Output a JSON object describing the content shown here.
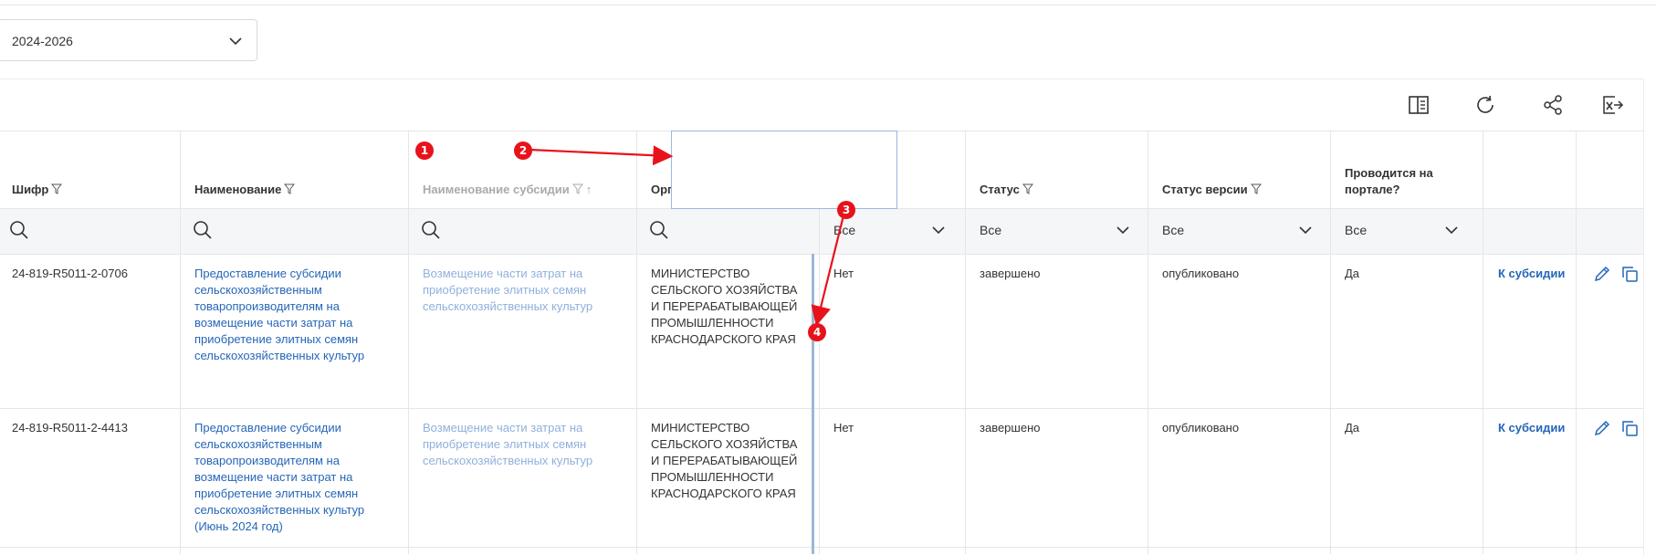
{
  "year_select": {
    "value": "2024-2026"
  },
  "toolbar": {
    "icons": [
      "columns-icon",
      "refresh-icon",
      "share-icon",
      "export-excel-icon"
    ]
  },
  "columns": [
    {
      "label": "Шифр",
      "filter": true
    },
    {
      "label": "Наименование",
      "filter": true
    },
    {
      "label": "Наименование субсидии",
      "filter": true,
      "sort": "↑"
    },
    {
      "label": "Орга",
      "filter": false
    },
    {
      "label": "Статус",
      "filter": true
    },
    {
      "label": "Статус версии",
      "filter": true
    },
    {
      "label": "Проводится на портале?",
      "filter": false
    }
  ],
  "filters": {
    "col5": "Все",
    "status": "Все",
    "version_status": "Все",
    "portal": "Все"
  },
  "rows": [
    {
      "code": "24-819-R5011-2-0706",
      "name": "Предоставление субсидии сельскохозяйственным товаропроизводителям на возмещение части затрат на приобретение элитных семян сельскохозяйственных культур",
      "subsidy": "Возмещение части затрат на приобретение элитных семян сельскохозяйственных культур",
      "org": "МИНИСТЕРСТВО СЕЛЬСКОГО ХОЗЯЙСТВА И ПЕРЕРАБАТЫВАЮЩЕЙ ПРОМЫШЛЕННОСТИ КРАСНОДАРСКОГО КРАЯ",
      "col5": "Нет",
      "status": "завершено",
      "version_status": "опубликовано",
      "portal": "Да",
      "action": "К субсидии"
    },
    {
      "code": "24-819-R5011-2-4413",
      "name": "Предоставление субсидии сельскохозяйственным товаропроизводителям на возмещение части затрат на приобретение элитных семян сельскохозяйственных культур (Июнь 2024 год)",
      "subsidy": "Возмещение части затрат на приобретение элитных семян сельскохозяйственных культур",
      "org": "МИНИСТЕРСТВО СЕЛЬСКОГО ХОЗЯЙСТВА И ПЕРЕРАБАТЫВАЮЩЕЙ ПРОМЫШЛЕННОСТИ КРАСНОДАРСКОГО КРАЯ",
      "col5": "Нет",
      "status": "завершено",
      "version_status": "опубликовано",
      "portal": "Да",
      "action": "К субсидии"
    }
  ],
  "annotations": {
    "badges": [
      "1",
      "2",
      "3",
      "4"
    ],
    "color": "#e8121b"
  }
}
